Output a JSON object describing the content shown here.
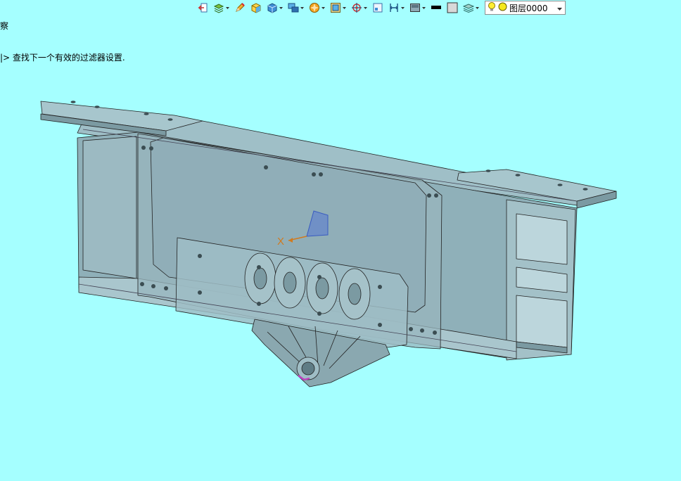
{
  "console": {
    "line1": "察",
    "line2": "|> 查找下一个有效的过滤器设置."
  },
  "toolbar": {
    "icons": [
      "import-icon",
      "layers-filter-icon",
      "pencil-icon",
      "box-3d-icon",
      "cube-icon",
      "multi-view-icon",
      "render-icon",
      "frame-icon",
      "snap-icon",
      "view-icon",
      "measure-icon",
      "display-mode-icon",
      "color-swatch-icon",
      "outline-swatch-icon",
      "layer-stack-icon"
    ],
    "layer": {
      "name": "图层0000",
      "bulb_color": "#ffee33",
      "state_color": "#f5e81b"
    }
  },
  "viewport": {
    "background": "#a5ffff",
    "model_color": "#8fb0b9",
    "edge_color": "#222222",
    "axis_label": "X",
    "axis_color": "#d07a1e"
  }
}
